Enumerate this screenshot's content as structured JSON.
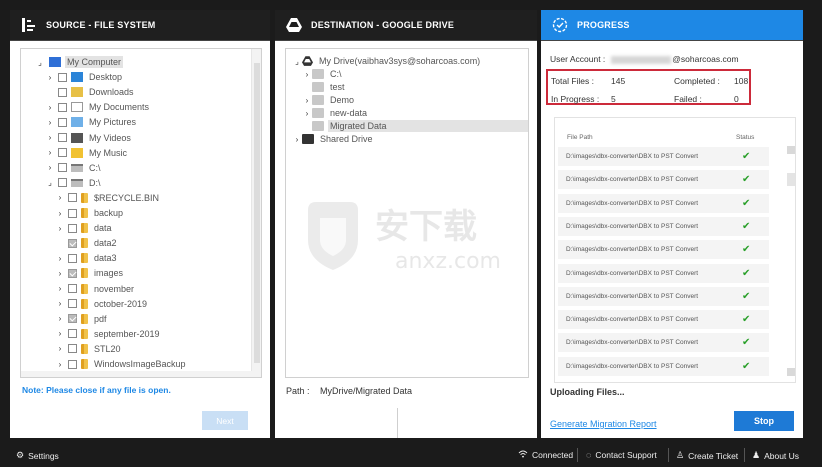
{
  "source": {
    "title": "SOURCE - FILE SYSTEM",
    "tree": [
      {
        "label": "My Computer",
        "arrow": "⌟",
        "cb": false,
        "icon": "pc",
        "indent": 0,
        "sel": true
      },
      {
        "label": "Desktop",
        "arrow": "›",
        "cb": true,
        "icon": "desk",
        "indent": 1
      },
      {
        "label": "Downloads",
        "arrow": "",
        "cb": true,
        "icon": "dl",
        "indent": 1
      },
      {
        "label": "My Documents",
        "arrow": "›",
        "cb": true,
        "icon": "doc",
        "indent": 1
      },
      {
        "label": "My Pictures",
        "arrow": "›",
        "cb": true,
        "icon": "pic",
        "indent": 1
      },
      {
        "label": "My Videos",
        "arrow": "›",
        "cb": true,
        "icon": "vid",
        "indent": 1
      },
      {
        "label": "My Music",
        "arrow": "›",
        "cb": true,
        "icon": "mus",
        "indent": 1
      },
      {
        "label": "C:\\",
        "arrow": "›",
        "cb": true,
        "icon": "drive",
        "indent": 1
      },
      {
        "label": "D:\\",
        "arrow": "⌟",
        "cb": true,
        "icon": "drive",
        "indent": 1
      },
      {
        "label": "$RECYCLE.BIN",
        "arrow": "›",
        "cb": true,
        "icon": "folder",
        "indent": 2
      },
      {
        "label": "backup",
        "arrow": "›",
        "cb": true,
        "icon": "folder",
        "indent": 2
      },
      {
        "label": "data",
        "arrow": "›",
        "cb": true,
        "icon": "folder",
        "indent": 2
      },
      {
        "label": "data2",
        "arrow": "",
        "cb": true,
        "chk": true,
        "icon": "folder",
        "indent": 2
      },
      {
        "label": "data3",
        "arrow": "›",
        "cb": true,
        "icon": "folder",
        "indent": 2
      },
      {
        "label": "images",
        "arrow": "›",
        "cb": true,
        "chk": true,
        "icon": "folder",
        "indent": 2
      },
      {
        "label": "november",
        "arrow": "›",
        "cb": true,
        "icon": "folder",
        "indent": 2
      },
      {
        "label": "october-2019",
        "arrow": "›",
        "cb": true,
        "icon": "folder",
        "indent": 2
      },
      {
        "label": "pdf",
        "arrow": "›",
        "cb": true,
        "chk": true,
        "icon": "folder",
        "indent": 2
      },
      {
        "label": "september-2019",
        "arrow": "›",
        "cb": true,
        "icon": "folder",
        "indent": 2
      },
      {
        "label": "STL20",
        "arrow": "›",
        "cb": true,
        "icon": "folder",
        "indent": 2
      },
      {
        "label": "WindowsImageBackup",
        "arrow": "›",
        "cb": true,
        "icon": "folder",
        "indent": 2
      }
    ],
    "note": "Note: Please close if any file is open.",
    "next_label": "Next"
  },
  "destination": {
    "title": "DESTINATION - GOOGLE DRIVE",
    "tree": [
      {
        "label": "My Drive(vaibhav3sys@soharcoas.com)",
        "arrow": "⌟",
        "icon": "gd",
        "indent": 0
      },
      {
        "label": "C:\\",
        "arrow": "›",
        "icon": "gfolder",
        "indent": 1
      },
      {
        "label": "test",
        "arrow": "",
        "icon": "gfolder",
        "indent": 1
      },
      {
        "label": "Demo",
        "arrow": "›",
        "icon": "gfolder",
        "indent": 1
      },
      {
        "label": "new-data",
        "arrow": "›",
        "icon": "gfolder",
        "indent": 1
      },
      {
        "label": "Migrated Data",
        "arrow": "",
        "icon": "gfolder",
        "indent": 1,
        "sel": true
      },
      {
        "label": "Shared Drive",
        "arrow": "›",
        "icon": "shared",
        "indent": 0
      }
    ],
    "path_label": "Path :",
    "path_value": "MyDrive/Migrated Data"
  },
  "progress": {
    "title": "PROGRESS",
    "user_label": "User Account :",
    "user_domain": "@soharcoas.com",
    "total_label": "Total Files :",
    "total_value": "145",
    "completed_label": "Completed :",
    "completed_value": "108",
    "inprogress_label": "In Progress :",
    "inprogress_value": "5",
    "failed_label": "Failed :",
    "failed_value": "0",
    "col_path": "File Path",
    "col_status": "Status",
    "rows": [
      "D:\\images\\dbx-converter\\DBX to PST Convert",
      "D:\\images\\dbx-converter\\DBX to PST Convert",
      "D:\\images\\dbx-converter\\DBX to PST Convert",
      "D:\\images\\dbx-converter\\DBX to PST Convert",
      "D:\\images\\dbx-converter\\DBX to PST Convert",
      "D:\\images\\dbx-converter\\DBX to PST Convert",
      "D:\\images\\dbx-converter\\DBX to PST Convert",
      "D:\\images\\dbx-converter\\DBX to PST Convert",
      "D:\\images\\dbx-converter\\DBX to PST Convert",
      "D:\\images\\dbx-converter\\DBX to PST Convert"
    ],
    "uploading": "Uploading Files...",
    "report_link": "Generate Migration Report",
    "stop_label": "Stop"
  },
  "statusbar": {
    "settings": "Settings",
    "connected": "Connected",
    "support": "Contact Support",
    "ticket": "Create Ticket",
    "about": "About Us"
  },
  "watermark": {
    "cn": "安下载",
    "en": "anxz.com"
  },
  "colors": {
    "accent": "#1e88e5",
    "highlight": "#cc2a3a",
    "success": "#2aa02a",
    "dark": "#1b1b1b"
  }
}
